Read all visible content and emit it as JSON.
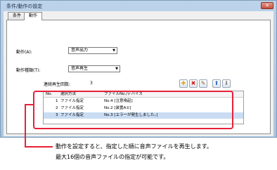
{
  "window": {
    "title": "条件/動作の設定",
    "close_glyph": "✕"
  },
  "tabs": [
    {
      "label": "条件"
    },
    {
      "label": "動作"
    }
  ],
  "form": {
    "action_label": "動作(A):",
    "action_value": "音声出力",
    "action_type_label": "動作種類(T):",
    "action_type_value": "音声再生",
    "repeat_label": "連続再生回数:",
    "repeat_value": "3"
  },
  "toolbar": {
    "icons": [
      "add-icon",
      "delete-icon",
      "edit-icon",
      "move-up-icon",
      "move-down-icon"
    ],
    "glyphs": {
      "add": "✚",
      "delete": "✖",
      "edit": "✎",
      "up": "⬆",
      "down": "⬇"
    }
  },
  "grid": {
    "columns": [
      "No.",
      "選択方法",
      "ファイルNo./デバイス"
    ],
    "rows": [
      {
        "no": "1",
        "method": "ファイル指定",
        "file": "No.4 [注意喚起]",
        "selected": false
      },
      {
        "no": "2",
        "method": "ファイル指定",
        "file": "No.2 [装置A①]",
        "selected": false
      },
      {
        "no": "3",
        "method": "ファイル指定",
        "file": "No.3 [エラーが発生しました。]",
        "selected": true
      }
    ]
  },
  "annotation": {
    "line1": "動作を設定すると、指定した順に音声ファイルを再生します。",
    "line2": "最大16個の音声ファイルの指定が可能です。",
    "color": "#e8203a"
  }
}
